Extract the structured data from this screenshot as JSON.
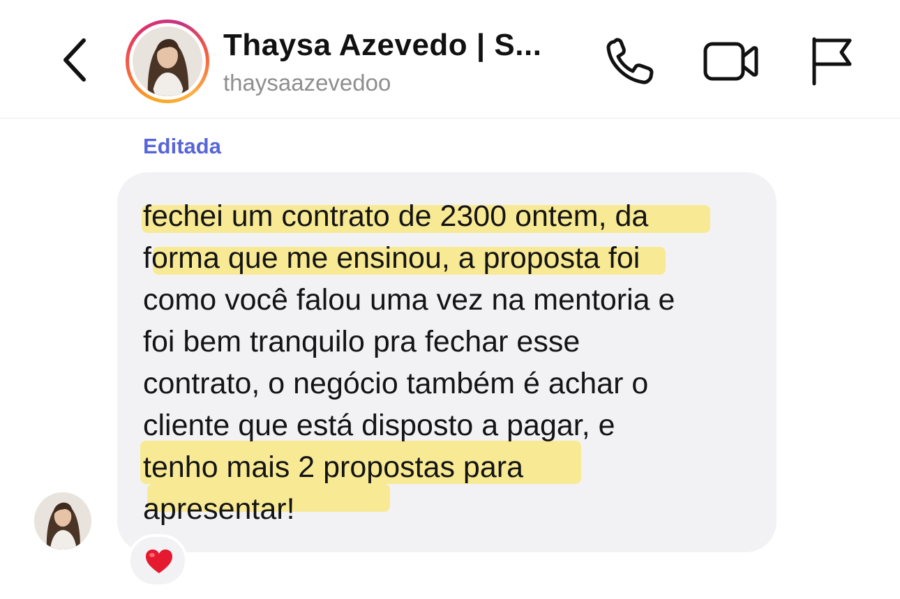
{
  "header": {
    "display_name": "Thaysa Azevedo | S...",
    "username": "thaysaazevedoo",
    "back_icon": "chevron-left-icon",
    "call_icon": "phone-icon",
    "video_icon": "video-camera-icon",
    "flag_icon": "flag-icon"
  },
  "message": {
    "edited_label": "Editada",
    "lines": [
      "fechei um contrato de 2300 ontem, da",
      "forma que me ensinou, a proposta foi",
      "como você falou uma vez na mentoria e",
      "foi bem tranquilo pra fechar esse",
      "contrato, o negócio também é achar o",
      "cliente que está disposto a pagar, e",
      "tenho mais 2 propostas para",
      "apresentar!"
    ],
    "reaction": "❤️"
  },
  "colors": {
    "accent": "#5865d6",
    "highlight": "#fae878",
    "bubble": "#f2f2f5",
    "heart": "#e5192f"
  }
}
